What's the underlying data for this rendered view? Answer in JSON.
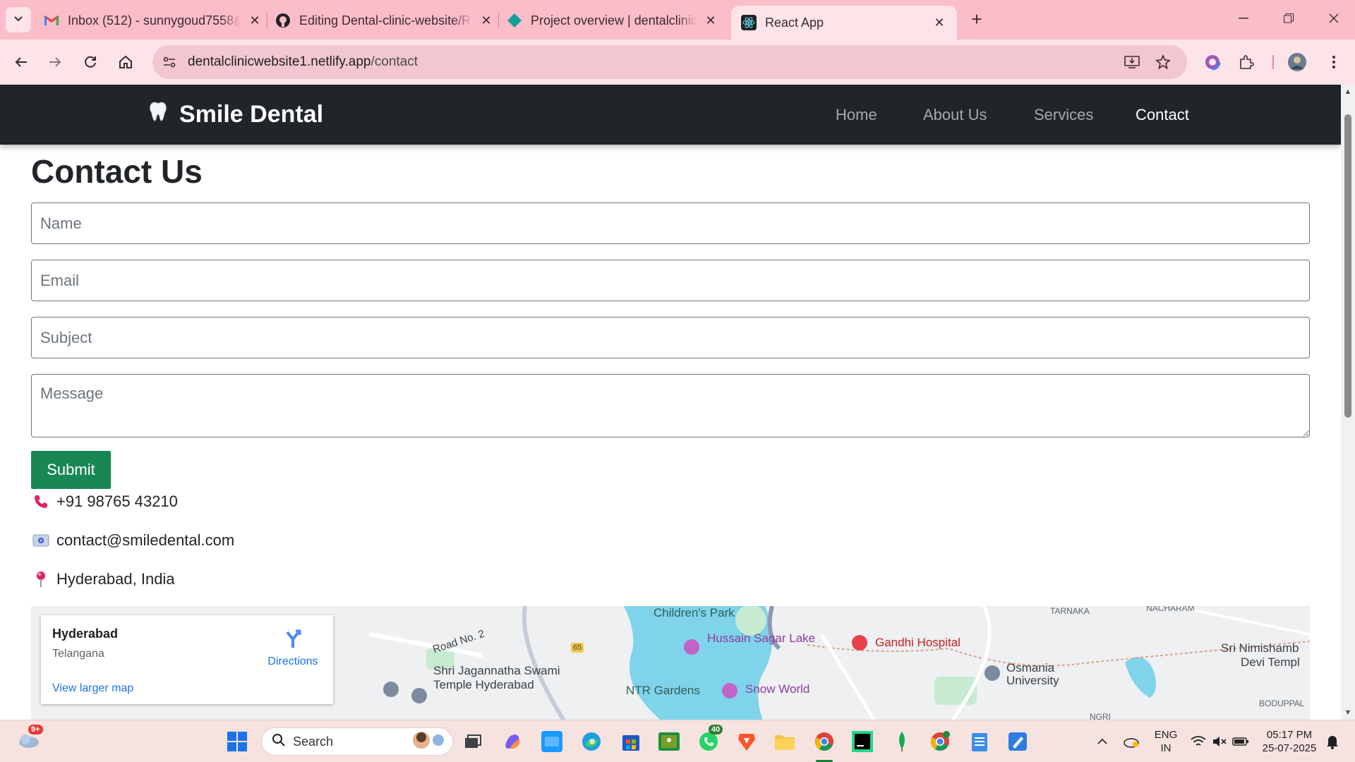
{
  "browser": {
    "tabs": [
      {
        "title": "Inbox (512) - sunnygoud7558@",
        "icon": "gmail-icon",
        "active": false
      },
      {
        "title": "Editing Dental-clinic-website/R",
        "icon": "github-icon",
        "active": false
      },
      {
        "title": "Project overview | dentalclinicw",
        "icon": "netlify-icon",
        "active": false
      },
      {
        "title": "React App",
        "icon": "react-icon",
        "active": true
      }
    ],
    "url_host": "dentalclinicwebsite1.netlify.app",
    "url_path": "/contact",
    "accent_color": "#fbbdc8"
  },
  "site": {
    "brand": "Smile Dental",
    "nav": [
      "Home",
      "About Us",
      "Services",
      "Contact"
    ],
    "active_nav": "Contact",
    "navbar_color": "#212529"
  },
  "contact": {
    "title": "Contact Us",
    "name_placeholder": "Name",
    "email_placeholder": "Email",
    "subject_placeholder": "Subject",
    "message_placeholder": "Message",
    "submit_label": "Submit",
    "submit_color": "#198754",
    "phone": "+91 98765 43210",
    "email": "contact@smiledental.com",
    "location": "Hyderabad, India"
  },
  "map": {
    "card_city": "Hyderabad",
    "card_region": "Telangana",
    "directions_label": "Directions",
    "view_larger_label": "View larger map",
    "labels": {
      "childrens_park": "Children's Park",
      "hussain_sagar": "Hussain Sagar Lake",
      "gandhi_hospital": "Gandhi Hospital",
      "tarnaka": "TARNAKA",
      "nacharam": "NACHARAM",
      "road_no_2": "Road No. 2",
      "jagannatha": "Shri Jagannatha Swami",
      "temple_hyd": "Temple Hyderabad",
      "ntr_gardens": "NTR Gardens",
      "snow_world": "Snow World",
      "osmania": "Osmania",
      "university": "University",
      "sri_nimishamba": "Sri Nimishamb",
      "devi_templ": "Devi Templ",
      "boduppal": "BODUPPAL",
      "ngri": "NGRI",
      "route_65": "65"
    }
  },
  "taskbar": {
    "search_placeholder": "Search",
    "weather_badge": "9+",
    "whatsapp_badge": "40",
    "language_line1": "ENG",
    "language_line2": "IN",
    "time": "05:17 PM",
    "date": "25-07-2025"
  }
}
